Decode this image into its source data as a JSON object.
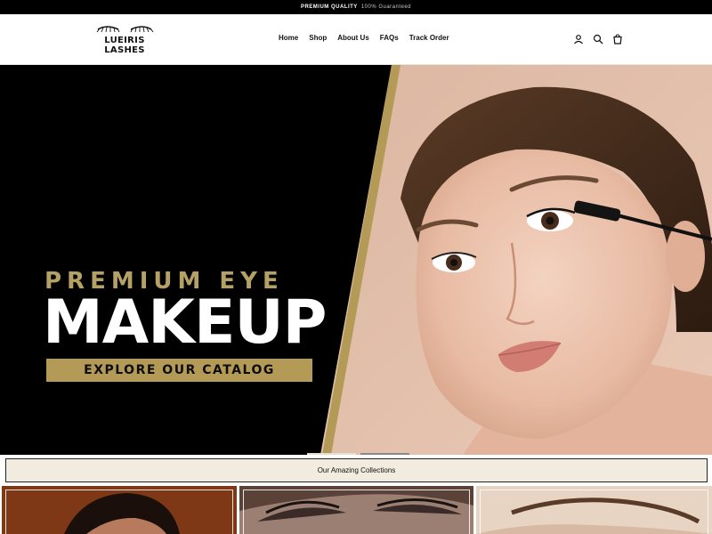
{
  "announcement": {
    "strong": "PREMIUM QUALITY",
    "rest": "100% Guaranteed"
  },
  "brand": {
    "line1": "LUEIRIS",
    "line2": "LASHES"
  },
  "nav": [
    "Home",
    "Shop",
    "About Us",
    "FAQs",
    "Track Order"
  ],
  "header_icons": [
    "account-icon",
    "search-icon",
    "cart-icon"
  ],
  "hero": {
    "kicker": "PREMIUM EYE",
    "headline": "MAKEUP",
    "cta": "EXPLORE OUR CATALOG"
  },
  "collections_label": "Our Amazing Collections",
  "colors": {
    "gold": "#b39a56",
    "cream": "#f1ecdf",
    "black": "#000000"
  }
}
